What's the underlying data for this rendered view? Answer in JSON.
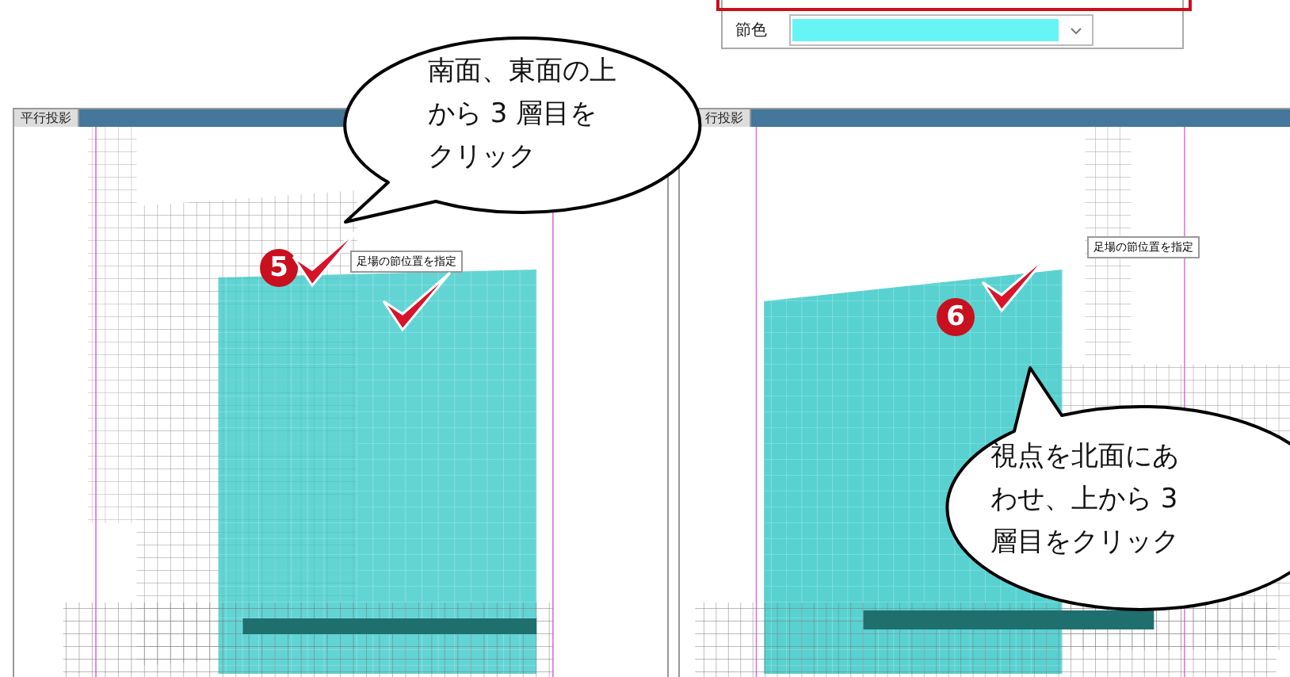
{
  "dialog": {
    "highlighted_field": {
      "selected": true
    },
    "color_field": {
      "label": "節色",
      "color": "#66f4f4"
    }
  },
  "viewports": [
    {
      "tab": "平行投影",
      "step": "5",
      "tooltip": "足場の節位置を指定"
    },
    {
      "tab": "行投影",
      "step": "6",
      "tooltip": "足場の節位置を指定"
    }
  ],
  "callouts": [
    {
      "lines": [
        "南面、東面の上",
        "から 3 層目を",
        "クリック"
      ]
    },
    {
      "lines": [
        "視点を北面にあ",
        "わせ、上から 3",
        "層目をクリック"
      ]
    }
  ]
}
